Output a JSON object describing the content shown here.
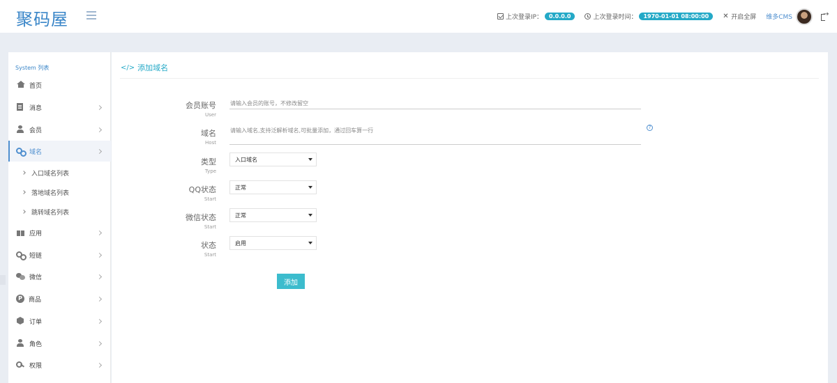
{
  "header": {
    "logo": "聚码屋",
    "last_ip_label": "上次登录IP：",
    "last_ip_value": "0.0.0.0",
    "last_time_label": "上次登录时间：",
    "last_time_value": "1970-01-01 08:00:00",
    "fullscreen_label": "开启全屏",
    "user_name": "维多CMS"
  },
  "sidebar": {
    "title": "System 列表",
    "items": [
      {
        "label": "首页",
        "icon": "home-icon"
      },
      {
        "label": "消息",
        "icon": "document-icon"
      },
      {
        "label": "会员",
        "icon": "user-icon"
      },
      {
        "label": "域名",
        "icon": "link-icon"
      },
      {
        "label": "应用",
        "icon": "gift-icon"
      },
      {
        "label": "短链",
        "icon": "link-icon"
      },
      {
        "label": "微信",
        "icon": "wechat-icon"
      },
      {
        "label": "商品",
        "icon": "product-icon"
      },
      {
        "label": "订单",
        "icon": "box-icon"
      },
      {
        "label": "角色",
        "icon": "user-icon"
      },
      {
        "label": "权限",
        "icon": "key-icon"
      }
    ],
    "sub_items": [
      "入口域名列表",
      "落地域名列表",
      "跳转域名列表"
    ]
  },
  "main": {
    "title": "添加域名",
    "fields": {
      "user": {
        "label": "会员账号",
        "sub": "User",
        "placeholder": "请输入会员的账号，不修改留空"
      },
      "host": {
        "label": "域名",
        "sub": "Host",
        "placeholder": "请输入域名,支持泛解析域名,可批量添加，通过回车算一行"
      },
      "type": {
        "label": "类型",
        "sub": "Type",
        "value": "入口域名"
      },
      "qq": {
        "label": "QQ状态",
        "sub": "Start",
        "value": "正常"
      },
      "wechat": {
        "label": "微信状态",
        "sub": "Start",
        "value": "正常"
      },
      "status": {
        "label": "状态",
        "sub": "Start",
        "value": "启用"
      }
    },
    "submit_label": "添加"
  },
  "colors": {
    "accent": "#24a9c7",
    "link": "#4f8fcf",
    "button": "#3cbccd"
  }
}
